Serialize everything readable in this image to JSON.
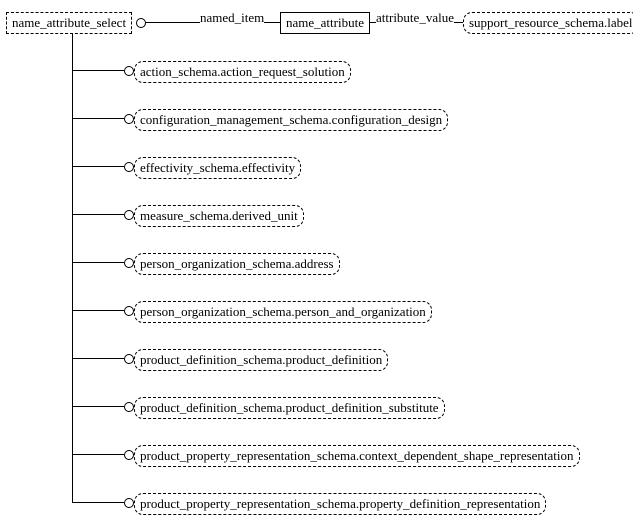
{
  "root": "name_attribute_select",
  "top_entity": "name_attribute",
  "right_entity": "support_resource_schema.label",
  "edge_named_item": "named_item",
  "edge_attribute_value": "attribute_value",
  "children": [
    "action_schema.action_request_solution",
    "configuration_management_schema.configuration_design",
    "effectivity_schema.effectivity",
    "measure_schema.derived_unit",
    "person_organization_schema.address",
    "person_organization_schema.person_and_organization",
    "product_definition_schema.product_definition",
    "product_definition_schema.product_definition_substitute",
    "product_property_representation_schema.context_dependent_shape_representation",
    "product_property_representation_schema.property_definition_representation"
  ]
}
